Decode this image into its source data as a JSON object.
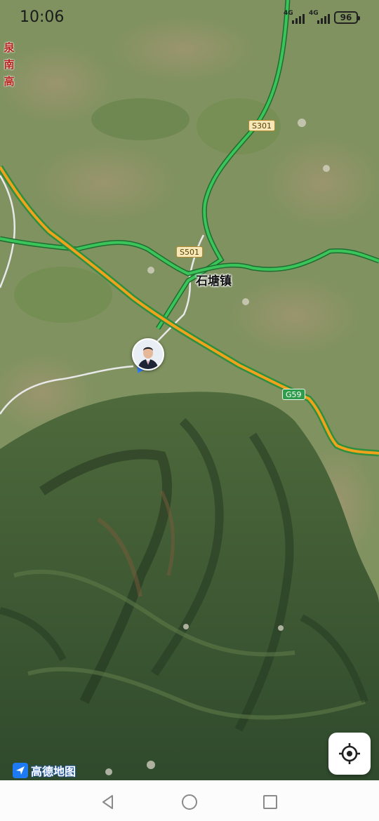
{
  "status_bar": {
    "time": "10:06",
    "network_1": "4G",
    "network_2": "4G",
    "battery": "96"
  },
  "map": {
    "place_label": "石塘镇",
    "highway_name_chars": [
      "泉",
      "南",
      "高"
    ],
    "road_shields": {
      "s301": "S301",
      "s501": "S501",
      "g59": "G59"
    },
    "colors": {
      "provincial_road": "#3bc45a",
      "expressway": "#f0a21d",
      "minor_road": "#e6e6e6",
      "current_location_arrow": "#2f7ef5"
    }
  },
  "brand": {
    "name": "高德地图"
  },
  "controls": {
    "locate_icon": "crosshair-icon"
  },
  "nav_bar": {
    "back_icon": "triangle-back-icon",
    "home_icon": "circle-home-icon",
    "recent_icon": "square-recent-icon"
  }
}
